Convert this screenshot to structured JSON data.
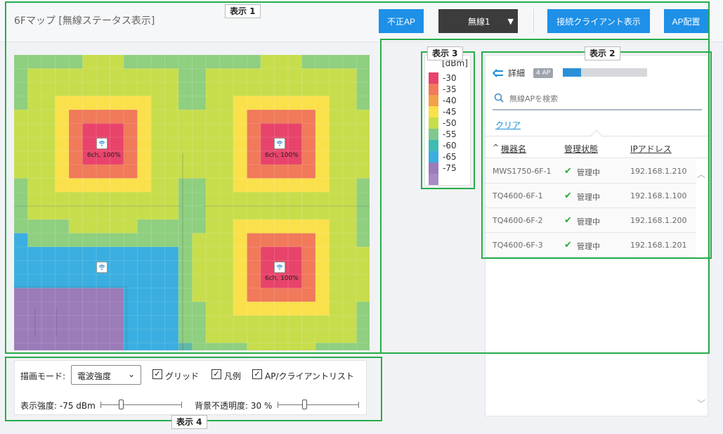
{
  "header": {
    "title": "6Fマップ [無線ステータス表示]",
    "rogue_ap_button": "不正AP",
    "radio_select": "無線1",
    "show_clients_button": "接続クライアント表示",
    "ap_placement_button": "AP配置"
  },
  "annotations": {
    "view1": "表示 1",
    "view2": "表示 2",
    "view3": "表示 3",
    "view4": "表示 4"
  },
  "map": {
    "aps": [
      {
        "label": "6ch, 100%"
      },
      {
        "label": "6ch, 100%"
      },
      {
        "label": "6ch, 100%"
      },
      {
        "label": ""
      }
    ]
  },
  "legend": {
    "unit": "[dBm]",
    "levels": [
      {
        "label": "-30",
        "color": "#e8436a"
      },
      {
        "label": "-35",
        "color": "#f07a5a"
      },
      {
        "label": "-40",
        "color": "#f3a04a"
      },
      {
        "label": "-45",
        "color": "#fae04b"
      },
      {
        "label": "-50",
        "color": "#c7dd4c"
      },
      {
        "label": "-55",
        "color": "#7fc98f"
      },
      {
        "label": "-60",
        "color": "#3fbcb0"
      },
      {
        "label": "-65",
        "color": "#3aaee0"
      },
      {
        "label": "-75",
        "color": "#9b7bb8"
      },
      {
        "label": "",
        "color": "#a88ac4"
      }
    ]
  },
  "panel": {
    "detail_label": "詳細",
    "ap_count": "4 AP",
    "progress_fraction": 0.22,
    "search_placeholder": "無線APを検索",
    "clear_label": "クリア",
    "columns": [
      "機器名",
      "管理状態",
      "IPアドレス"
    ],
    "rows": [
      {
        "name": "MWS1750-6F-1",
        "status": "管理中",
        "ip": "192.168.1.210"
      },
      {
        "name": "TQ4600-6F-1",
        "status": "管理中",
        "ip": "192.168.1.100"
      },
      {
        "name": "TQ4600-6F-2",
        "status": "管理中",
        "ip": "192.168.1.200"
      },
      {
        "name": "TQ4600-6F-3",
        "status": "管理中",
        "ip": "192.168.1.201"
      }
    ]
  },
  "controls": {
    "draw_mode_label": "描画モード:",
    "draw_mode_value": "電波強度",
    "grid_label": "グリッド",
    "legend_label": "凡例",
    "aplist_label": "AP/クライアントリスト",
    "strength_label": "表示強度: -75 dBm",
    "strength_fraction": 0.22,
    "opacity_label": "背景不透明度: 30 %",
    "opacity_fraction": 0.3
  }
}
